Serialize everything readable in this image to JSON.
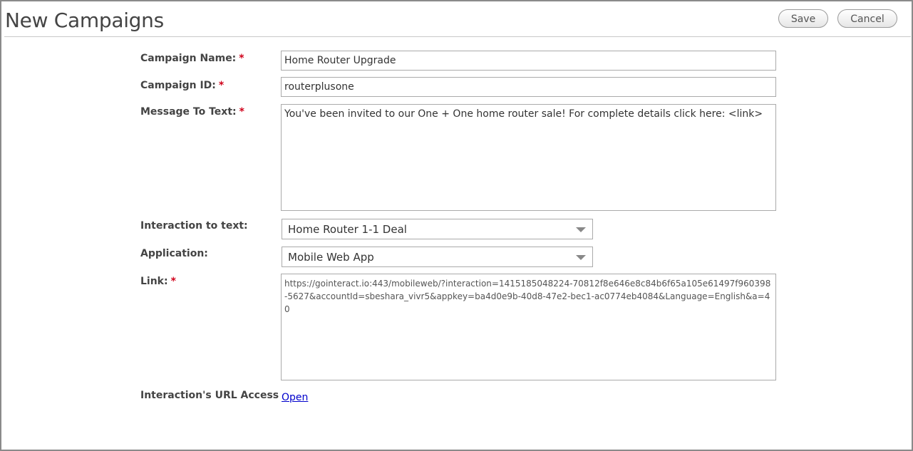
{
  "header": {
    "title": "New Campaigns",
    "save_label": "Save",
    "cancel_label": "Cancel"
  },
  "form": {
    "required_marker": "*",
    "campaign_name": {
      "label": "Campaign Name:",
      "value": "Home Router Upgrade"
    },
    "campaign_id": {
      "label": "Campaign ID:",
      "value": "routerplusone"
    },
    "message": {
      "label": "Message To Text:",
      "value": "You've been invited to our One + One home router sale! For complete details click here: <link>"
    },
    "interaction": {
      "label": "Interaction to text:",
      "selected": "Home Router 1-1 Deal"
    },
    "application": {
      "label": "Application:",
      "selected": "Mobile Web App"
    },
    "link": {
      "label": "Link:",
      "value": "https://gointeract.io:443/mobileweb/?interaction=1415185048224-70812f8e646e8c84b6f65a105e61497f960398-5627&accountId=sbeshara_vivr5&appkey=ba4d0e9b-40d8-47e2-bec1-ac0774eb4084&Language=English&a=40"
    },
    "url_access": {
      "label": "Interaction's URL Access",
      "link_text": "Open"
    }
  }
}
